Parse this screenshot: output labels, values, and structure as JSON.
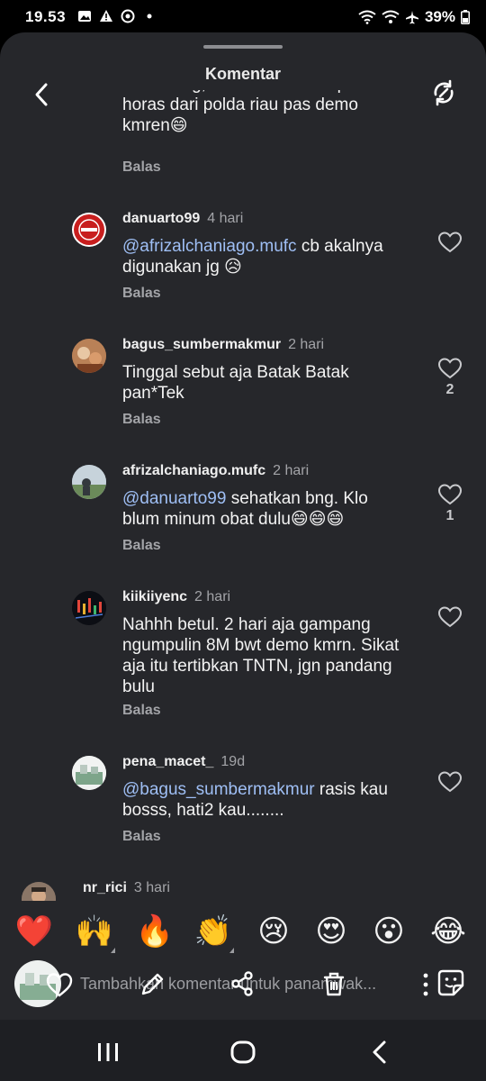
{
  "status_bar": {
    "time": "19.53",
    "battery": "39%"
  },
  "header": {
    "title": "Komentar"
  },
  "reply_label": "Balas",
  "partial_top": {
    "text": "TNTN bng, coba liat vidio sapaan horas dari polda riau pas demo kmren😄"
  },
  "comments": [
    {
      "username": "danuarto99",
      "time": "4 hari",
      "mention": "@afrizalchaniago.mufc",
      "text": " cb akalnya digunakan jg 😥",
      "likes": ""
    },
    {
      "username": "bagus_sumbermakmur",
      "time": "2 hari",
      "mention": "",
      "text": "Tinggal sebut aja Batak Batak pan*Tek",
      "likes": "2"
    },
    {
      "username": "afrizalchaniago.mufc",
      "time": "2 hari",
      "mention": "@danuarto99",
      "text": " sehatkan bng. Klo blum minum obat dulu😄😄😄",
      "likes": "1"
    },
    {
      "username": "kiikiiyenc",
      "time": "2 hari",
      "mention": "",
      "text": "Nahhh betul. 2 hari aja gampang ngumpulin 8M bwt demo kmrn. Sikat aja itu tertibkan TNTN, jgn pandang bulu",
      "likes": ""
    },
    {
      "username": "pena_macet_",
      "time": "19d",
      "mention": "@bagus_sumbermakmur",
      "text": " rasis kau bosss, hati2 kau........",
      "likes": ""
    },
    {
      "username": "nr_rici",
      "time": "3 hari",
      "mention": "",
      "text": "",
      "likes": ""
    }
  ],
  "emoji_reactions": [
    "❤️",
    "🙌",
    "🔥",
    "👏",
    "😢",
    "😍",
    "😮",
    "😂"
  ],
  "composer": {
    "placeholder": "Tambahkan komentar untuk panamwak..."
  },
  "icons": {
    "back": "chevron-left-icon",
    "swap": "refresh-icon",
    "like": "heart-outline-icon",
    "sticker": "sticker-icon",
    "nav_recents": "recent-apps-icon",
    "nav_home": "home-icon",
    "nav_back": "back-icon"
  },
  "colors": {
    "sheet_bg": "#26272b",
    "mention": "#9fbff5",
    "muted": "#a3a4a8"
  }
}
